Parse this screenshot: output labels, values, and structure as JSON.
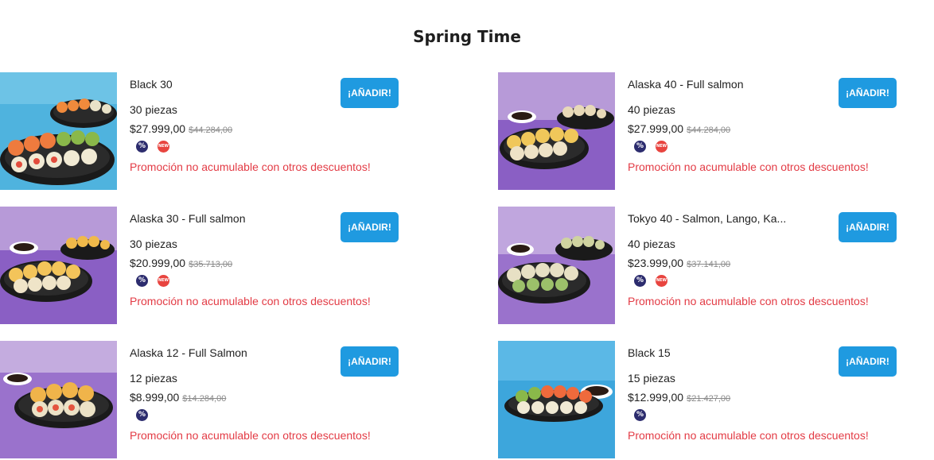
{
  "section": {
    "title": "Spring Time"
  },
  "products": [
    {
      "name": "Black 30",
      "pieces": "30 piezas",
      "price": "$27.999,00",
      "old_price": "$44.284,00",
      "add_label": "¡AÑADIR!",
      "promo": "Promoción no acumulable con otros descuentos!",
      "badge_discount": "%",
      "badge_new": "NEW"
    },
    {
      "name": "Alaska 40 - Full salmon",
      "pieces": "40 piezas",
      "price": "$27.999,00",
      "old_price": "$44.284,00",
      "add_label": "¡AÑADIR!",
      "promo": "Promoción no acumulable con otros descuentos!",
      "badge_discount": "%",
      "badge_new": "NEW"
    },
    {
      "name": "Alaska 30 - Full salmon",
      "pieces": "30 piezas",
      "price": "$20.999,00",
      "old_price": "$35.713,00",
      "add_label": "¡AÑADIR!",
      "promo": "Promoción no acumulable con otros descuentos!",
      "badge_discount": "%",
      "badge_new": "NEW"
    },
    {
      "name": "Tokyo 40 - Salmon, Lango, Ka...",
      "pieces": "40 piezas",
      "price": "$23.999,00",
      "old_price": "$37.141,00",
      "add_label": "¡AÑADIR!",
      "promo": "Promoción no acumulable con otros descuentos!",
      "badge_discount": "%",
      "badge_new": "NEW"
    },
    {
      "name": "Alaska 12 - Full Salmon",
      "pieces": "12 piezas",
      "price": "$8.999,00",
      "old_price": "$14.284,00",
      "add_label": "¡AÑADIR!",
      "promo": "Promoción no acumulable con otros descuentos!",
      "badge_discount": "%"
    },
    {
      "name": "Black 15",
      "pieces": "15 piezas",
      "price": "$12.999,00",
      "old_price": "$21.427,00",
      "add_label": "¡AÑADIR!",
      "promo": "Promoción no acumulable con otros descuentos!",
      "badge_discount": "%"
    }
  ],
  "colors": {
    "accent": "#1f9ae0",
    "promo_text": "#e33b45",
    "discount_badge": "#2c2c6e",
    "new_badge": "#e8443f",
    "bg_blue": "#4fb3de",
    "bg_purple": "#8a5fc4"
  }
}
